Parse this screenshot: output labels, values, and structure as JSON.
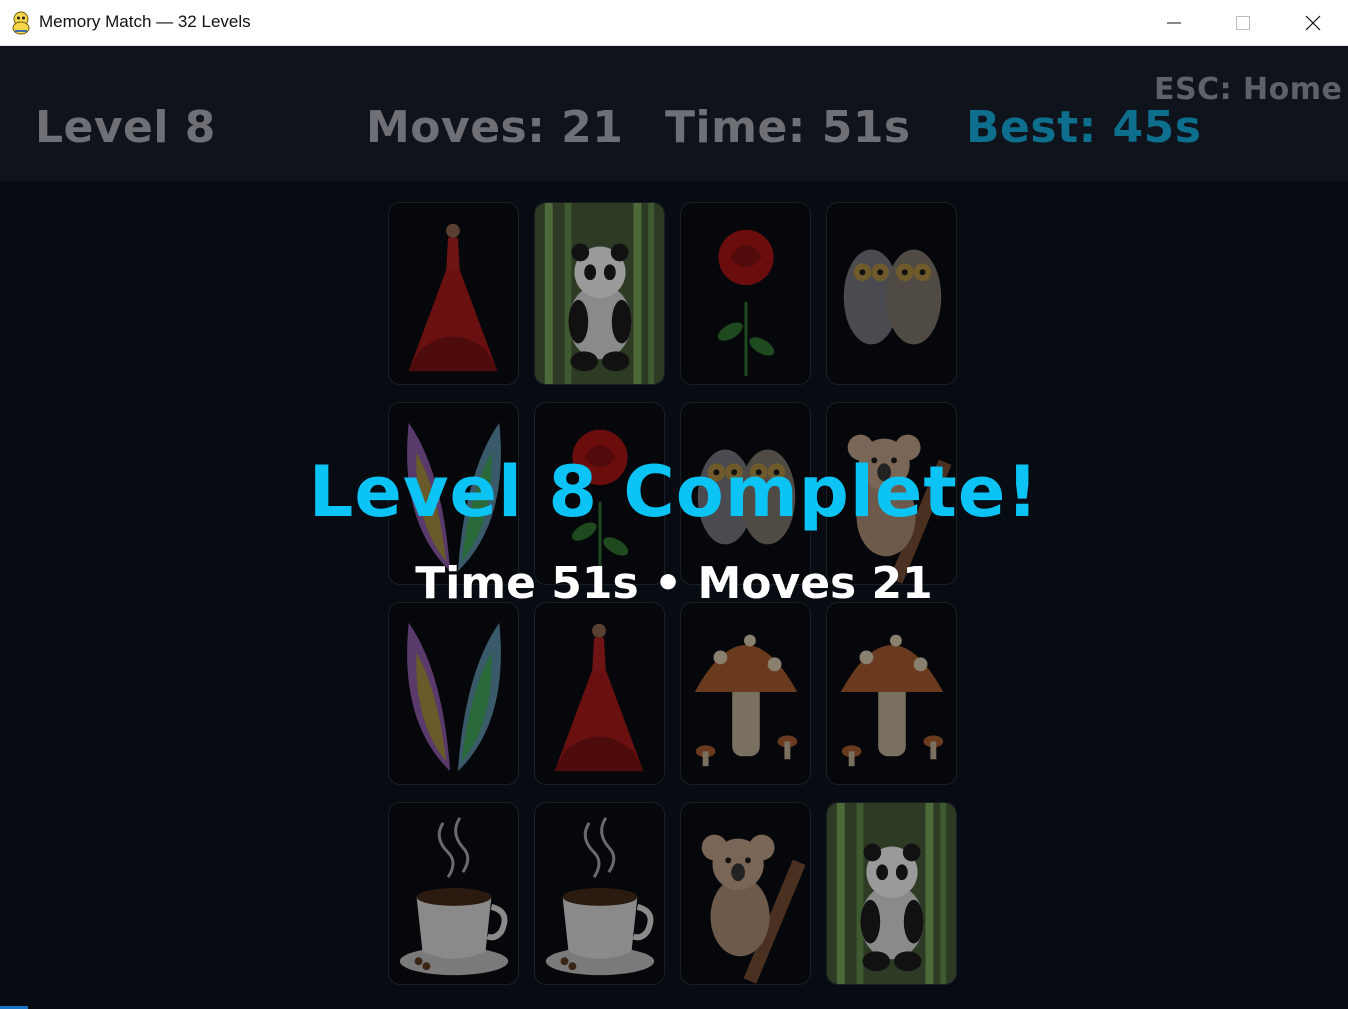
{
  "window": {
    "title": "Memory Match — 32 Levels",
    "app_icon": "python-snake-icon",
    "controls": [
      "minimize-icon",
      "maximize-icon",
      "close-icon"
    ]
  },
  "hud": {
    "level": "Level 8",
    "moves": "Moves: 21",
    "time": "Time: 51s",
    "best": "Best: 45s",
    "esc_hint": "ESC: Home",
    "best_color": "#0d6f8d"
  },
  "board": {
    "rows": 4,
    "cols": 4,
    "cards": [
      [
        "red-gown-lady",
        "panda-bamboo",
        "red-rose",
        "owl-pair"
      ],
      [
        "rainbow-wings",
        "red-rose",
        "owl-pair",
        "koala-branch"
      ],
      [
        "rainbow-wings",
        "red-gown-lady",
        "mushroom",
        "mushroom"
      ],
      [
        "coffee-cup",
        "coffee-cup",
        "koala-branch",
        "panda-bamboo"
      ]
    ]
  },
  "overlay": {
    "title": "Level 8 Complete!",
    "time_text": "Time 51s",
    "separator": " • ",
    "moves_text": "Moves 21",
    "title_color": "#0cc3f5"
  }
}
